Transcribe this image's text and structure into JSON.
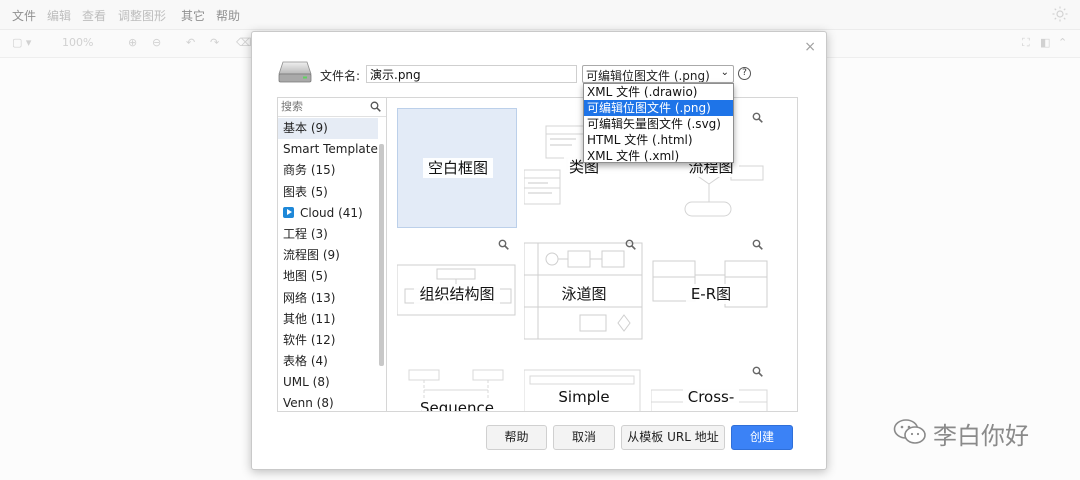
{
  "menubar": {
    "items": [
      "文件",
      "编辑",
      "查看",
      "调整图形",
      "其它",
      "帮助"
    ]
  },
  "toolbar": {
    "zoom": "100%"
  },
  "dialog": {
    "filename_label": "文件名:",
    "filename_value": "演示.png",
    "format_selected": "可编辑位图文件 (.png)",
    "format_options": [
      "XML 文件 (.drawio)",
      "可编辑位图文件 (.png)",
      "可编辑矢量图文件 (.svg)",
      "HTML 文件 (.html)",
      "XML 文件 (.xml)"
    ],
    "help_glyph": "?",
    "close_glyph": "×",
    "search_placeholder": "搜索",
    "categories": [
      "基本 (9)",
      "Smart Template",
      "商务 (15)",
      "图表 (5)",
      "Cloud (41)",
      "工程 (3)",
      "流程图 (9)",
      "地图 (5)",
      "网络 (13)",
      "其他 (11)",
      "软件 (12)",
      "表格 (4)",
      "UML (8)",
      "Venn (8)"
    ],
    "templates": [
      "空白框图",
      "类图",
      "流程图",
      "组织结构图",
      "泳道图",
      "E-R图",
      "Sequence",
      "Simple",
      "Cross-"
    ],
    "buttons": {
      "help": "帮助",
      "cancel": "取消",
      "from_url": "从模板 URL 地址",
      "create": "创建"
    }
  },
  "watermark": {
    "text": "李白你好"
  },
  "colors": {
    "accent": "#3b82f6",
    "selection": "#1e74e8",
    "selected_tile": "#e3ebf7"
  }
}
